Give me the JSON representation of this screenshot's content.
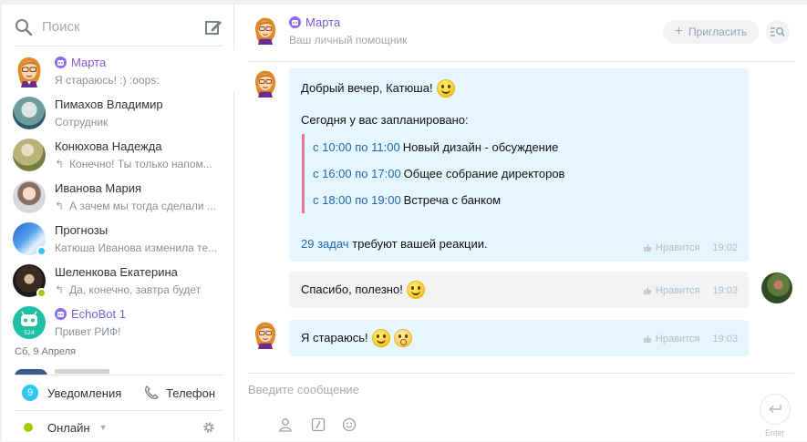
{
  "sidebar": {
    "search_placeholder": "Поиск",
    "chats": [
      {
        "name": "Марта",
        "message": "Я стараюсь! :) :oops:",
        "bot": true,
        "reply": false
      },
      {
        "name": "Пимахов Владимир",
        "message": "Сотрудник",
        "bot": false,
        "reply": false
      },
      {
        "name": "Конюхова Надежда",
        "message": "Конечно! Ты только напом...",
        "bot": false,
        "reply": true
      },
      {
        "name": "Иванова Мария",
        "message": "А зачем мы тогда сделали ...",
        "bot": false,
        "reply": true
      },
      {
        "name": "Прогнозы",
        "message": "Катюша Иванова изменила те...",
        "bot": false,
        "reply": false
      },
      {
        "name": "Шеленкова Екатерина",
        "message": "Да, конечно, завтра будет",
        "bot": false,
        "reply": true
      },
      {
        "name": "EchoBot 1",
        "message": "Привет РИФ!",
        "bot": true,
        "reply": false
      }
    ],
    "date_separator": "Сб, 9 Апреля",
    "notifications_count": "9",
    "notifications_label": "Уведомления",
    "phone_label": "Телефон",
    "status_label": "Онлайн",
    "echobot_avatar_label": "524"
  },
  "header": {
    "name": "Марта",
    "subtitle": "Ваш личный помощник",
    "invite_label": "Пригласить"
  },
  "messages": {
    "m1": {
      "greeting": "Добрый вечер, Катюша!",
      "intro": "Сегодня у вас запланировано:",
      "schedule": [
        {
          "time": "с 10:00 по 11:00",
          "title": "Новый дизайн - обсуждение"
        },
        {
          "time": "с 16:00 по 17:00",
          "title": "Общее собрание директоров"
        },
        {
          "time": "с 18:00 по 19:00",
          "title": "Встреча с банком"
        }
      ],
      "tasks_link": "29 задач",
      "tasks_text": "требуют вашей реакции.",
      "like": "Нравится",
      "time": "19:02"
    },
    "m2": {
      "text": "Спасибо, полезно!",
      "like": "Нравится",
      "time": "19:03"
    },
    "m3": {
      "text": "Я стараюсь!",
      "like": "Нравится",
      "time": "19:03"
    }
  },
  "composer": {
    "placeholder": "Введите сообщение",
    "enter_label": "Enter"
  },
  "colors": {
    "accent_bot": "#7b5bd6",
    "link": "#2067b0",
    "bubble_out": "#e6f6fe",
    "bubble_in": "#f1f3f4",
    "schedule_bar": "#e87592",
    "online": "#9dcf00",
    "notif_badge": "#2fc6f6"
  }
}
